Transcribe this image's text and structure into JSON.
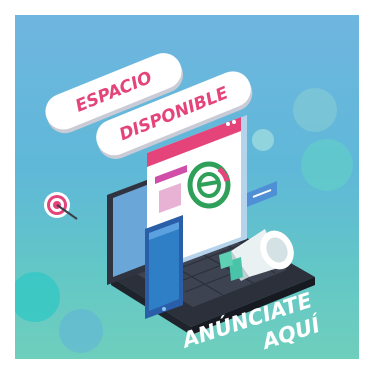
{
  "banner": {
    "pill_top": "ESPACIO",
    "pill_bottom": "DISPONIBLE",
    "cta_line1": "ANÚNCIATE",
    "cta_line2": "AQUÍ"
  },
  "colors": {
    "background_top": "#6fb6e0",
    "background_bottom": "#6fcfbd",
    "accent_pink": "#e4447a",
    "logo_green": "#2ea05a",
    "screen_blue": "#2f7fc7",
    "laptop_dark": "#2f3440"
  },
  "icons": {
    "target": "target-icon",
    "megaphone": "megaphone-icon",
    "logo": "e-logo-icon",
    "phone": "smartphone-icon",
    "laptop": "laptop-icon"
  }
}
